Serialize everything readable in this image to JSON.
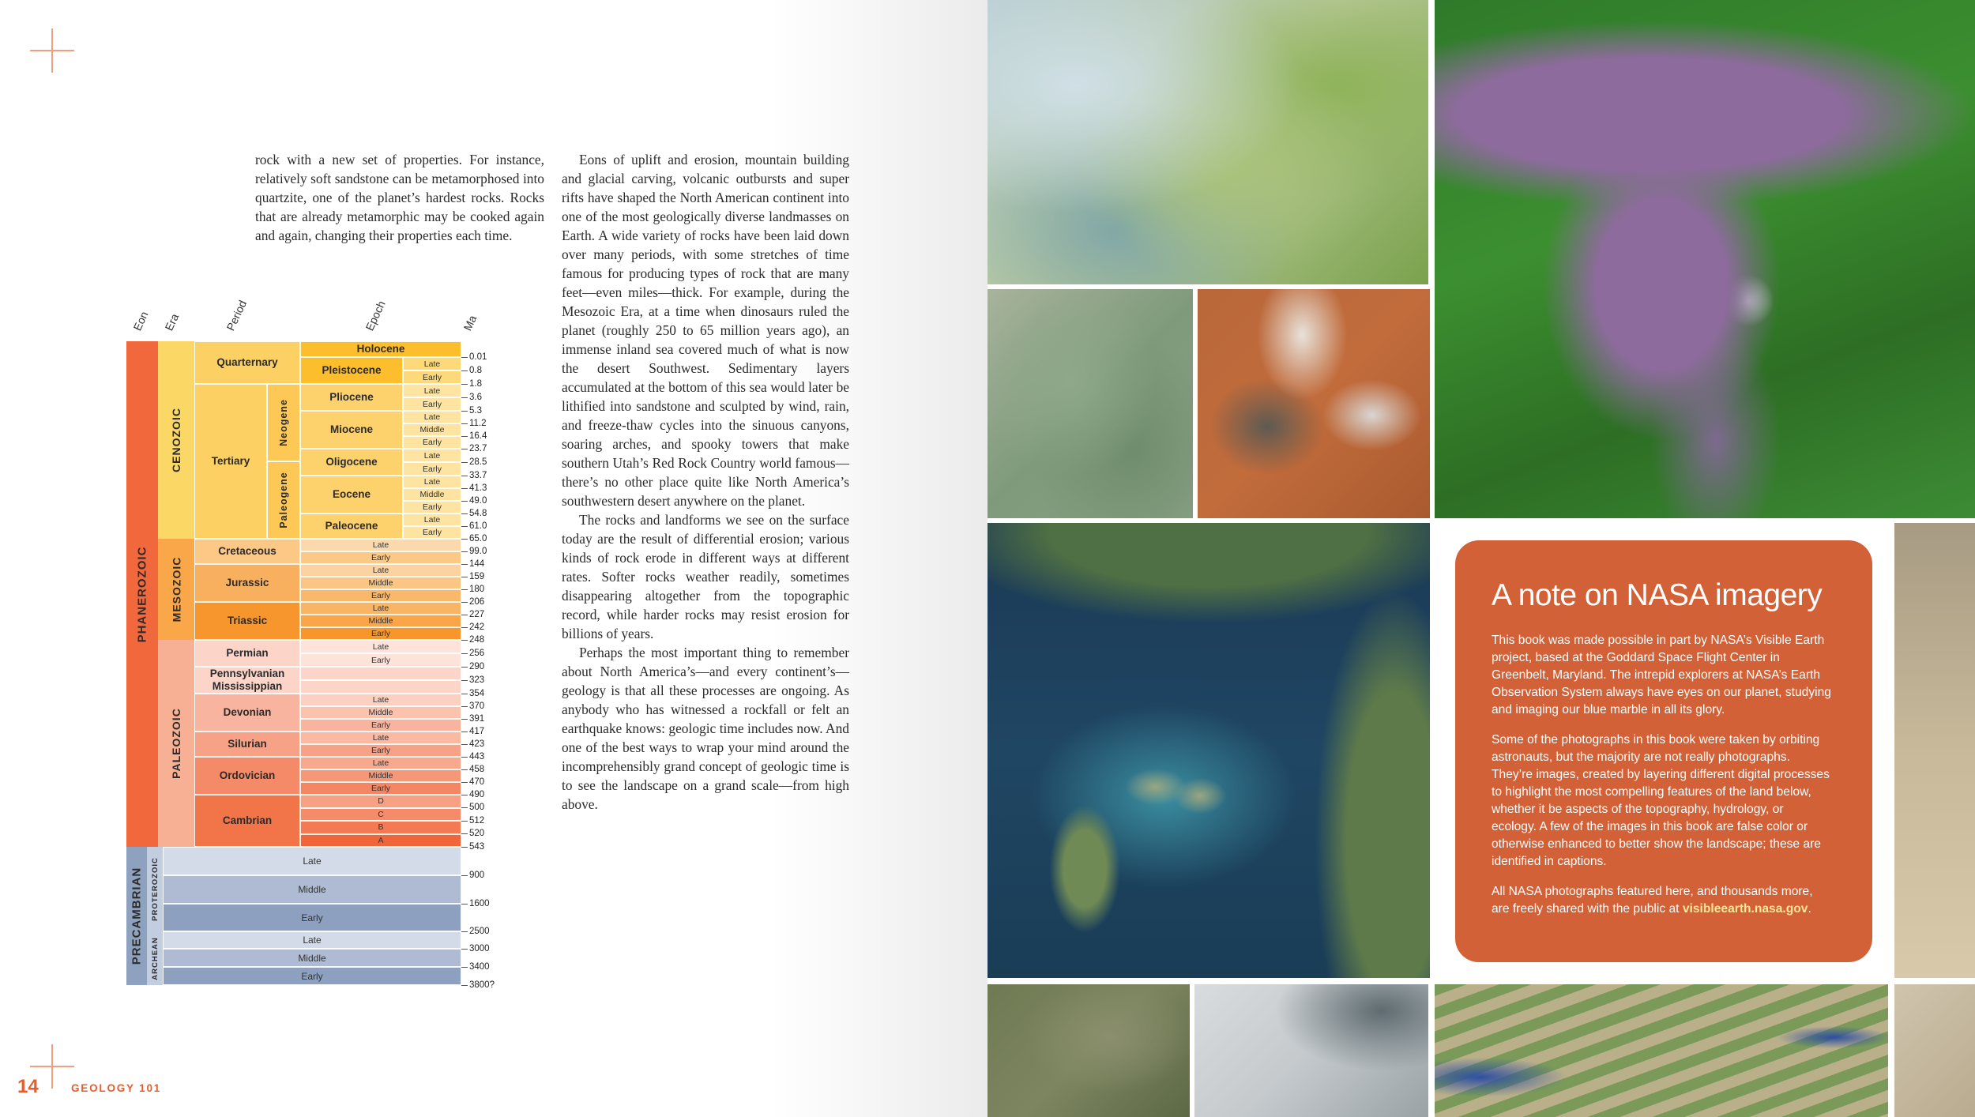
{
  "folio": {
    "page_number": "14",
    "running_head": "GEOLOGY 101"
  },
  "text": {
    "col1": "rock with a new set of properties. For instance, relatively soft sandstone can be metamorphosed into quartzite, one of the planet’s hardest rocks. Rocks that are already metamorphic may be cooked again and again, changing their properties each time.",
    "col2_p1": "Eons of uplift and erosion, mountain building and glacial carving, volcanic outbursts and super rifts have shaped the North American continent into one of the most geologically diverse landmasses on Earth. A wide variety of rocks have been laid down over many periods, with some stretches of time famous for producing types of rock that are many feet—even miles—thick. For example, during the Mesozoic Era, at a time when dinosaurs ruled the planet (roughly 250 to 65 million years ago), an immense inland sea covered much of what is now the desert Southwest. Sedimentary layers accumulated at the bottom of this sea would later be lithified into sandstone and sculpted by wind, rain, and freeze-thaw cycles into the sinuous canyons, soaring arches, and spooky towers that make southern Utah’s Red Rock Country world famous—there’s no other place quite like North America’s southwestern desert anywhere on the planet.",
    "col2_p2": "The rocks and landforms we see on the surface today are the result of differential erosion; various kinds of rock erode in different ways at different rates. Softer rocks weather readily, sometimes disappearing altogether from the topographic record, while harder rocks may resist erosion for billions of years.",
    "col2_p3": "Perhaps the most important thing to remember about North America’s—and every continent’s—geology is that all these processes are ongoing. As anybody who has witnessed a rockfall or felt an earthquake knows: geologic time includes now. And one of the best ways to wrap your mind around the incomprehensibly grand concept of geologic time is to see the landscape on a grand scale—from high above."
  },
  "timescale": {
    "headers": {
      "eon": "Eon",
      "era": "Era",
      "period": "Period",
      "epoch": "Epoch",
      "ma": "Ma"
    },
    "eons": {
      "phanerozoic": "PHANEROZOIC",
      "precambrian": "PRECAMBRIAN"
    },
    "eras": {
      "cenozoic": "CENOZOIC",
      "mesozoic": "MESOZOIC",
      "paleozoic": "PALEOZOIC",
      "proterozoic": "PROTEROZOIC",
      "archean": "ARCHEAN"
    },
    "periods": {
      "quarternary": "Quarternary",
      "tertiary": "Tertiary",
      "neogene": "Neogene",
      "paleogene": "Paleogene",
      "cretaceous": "Cretaceous",
      "jurassic": "Jurassic",
      "triassic": "Triassic",
      "permian": "Permian",
      "pennsylvanian": "Pennsylvanian",
      "mississippian": "Mississippian",
      "devonian": "Devonian",
      "silurian": "Silurian",
      "ordovician": "Ordovician",
      "cambrian": "Cambrian"
    },
    "epochs": {
      "holocene": "Holocene",
      "pleistocene": "Pleistocene",
      "pliocene": "Pliocene",
      "miocene": "Miocene",
      "oligocene": "Oligocene",
      "eocene": "Eocene",
      "paleocene": "Paleocene"
    },
    "sub": {
      "late": "Late",
      "middle": "Middle",
      "early": "Early",
      "d": "D",
      "c": "C",
      "b": "B",
      "a": "A"
    },
    "ma_values": [
      "0.01",
      "0.8",
      "1.8",
      "3.6",
      "5.3",
      "11.2",
      "16.4",
      "23.7",
      "28.5",
      "33.7",
      "41.3",
      "49.0",
      "54.8",
      "61.0",
      "65.0",
      "99.0",
      "144",
      "159",
      "180",
      "206",
      "227",
      "242",
      "248",
      "256",
      "290",
      "323",
      "354",
      "370",
      "391",
      "417",
      "423",
      "443",
      "458",
      "470",
      "490",
      "500",
      "512",
      "520",
      "543",
      "900",
      "1600",
      "2500",
      "3000",
      "3400",
      "3800?"
    ]
  },
  "note": {
    "title": "A note on NASA imagery",
    "p1": "This book was made possible in part by NASA’s Visible Earth project, based at the Goddard Space Flight Center in Greenbelt, Maryland. The intrepid explorers at NASA’s Earth Observation System always have eyes on our planet, studying and imaging our blue marble in all its glory.",
    "p2": "Some of the photographs in this book were taken by orbiting astronauts, but the majority are not really photographs. They’re images, created by layering different digital processes to highlight the most compelling features of the land below, whether it be aspects of the topography, hydrology, or ecology. A few of the images in this book are false color or otherwise enhanced to better show the landscape; these are identified in captions.",
    "p3": "All NASA photographs featured here, and thousands more, are freely shared with the public at",
    "link": "visibleearth.nasa.gov",
    "end": "."
  },
  "colors": {
    "accent": "#e85d2c",
    "note_bg": "#d26137"
  }
}
